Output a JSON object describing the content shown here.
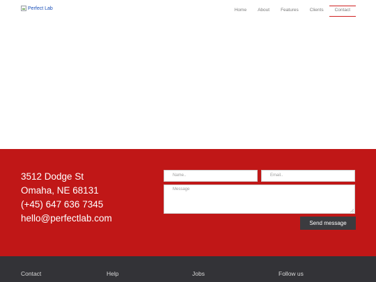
{
  "header": {
    "logo_alt": "Perfect Lab",
    "nav": [
      {
        "label": "Home"
      },
      {
        "label": "About"
      },
      {
        "label": "Features"
      },
      {
        "label": "Clients"
      },
      {
        "label": "Contact",
        "active": true
      }
    ]
  },
  "contact": {
    "address": [
      "3512 Dodge St",
      "Omaha, NE 68131",
      "(+45) 647 636 7345",
      "hello@perfectlab.com"
    ],
    "form": {
      "name_placeholder": "Name..",
      "email_placeholder": "Email..",
      "message_placeholder": "Message",
      "send_label": "Send message"
    }
  },
  "footer": {
    "columns": [
      "Contact",
      "Help",
      "Jobs",
      "Follow us"
    ]
  },
  "colors": {
    "accent_red": "#c01717",
    "footer_dark": "#333337",
    "button_dark": "#3b3b3f"
  },
  "icons": [
    "broken-image-icon",
    "resize-grip-icon"
  ]
}
